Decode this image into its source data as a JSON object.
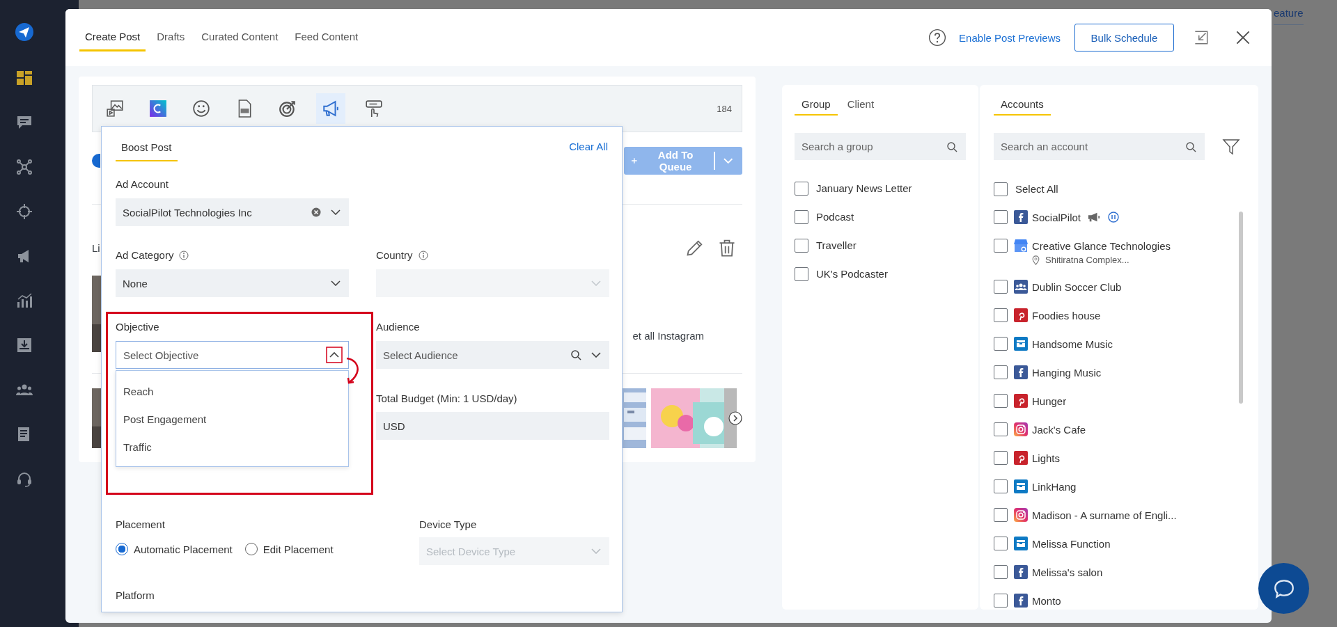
{
  "sidebar": {
    "items": [
      {
        "kind": "dashboard",
        "selected": true
      },
      {
        "kind": "chat",
        "selected": false
      },
      {
        "kind": "network",
        "selected": false
      },
      {
        "kind": "target",
        "selected": false
      },
      {
        "kind": "megaphone",
        "selected": false
      },
      {
        "kind": "chart",
        "selected": false
      },
      {
        "kind": "inbox",
        "selected": false
      },
      {
        "kind": "people",
        "selected": false
      },
      {
        "kind": "document",
        "selected": false
      },
      {
        "kind": "headset",
        "selected": false
      }
    ]
  },
  "background": {
    "partial_text": "eature"
  },
  "modal": {
    "tabs": [
      {
        "label": "Create Post",
        "selected": true
      },
      {
        "label": "Drafts",
        "selected": false
      },
      {
        "label": "Curated Content",
        "selected": false
      },
      {
        "label": "Feed Content",
        "selected": false
      }
    ],
    "preview_link": "Enable Post Previews",
    "bulk_button": "Bulk Schedule"
  },
  "composer": {
    "tools": [
      {
        "kind": "media",
        "selected": false
      },
      {
        "kind": "canva",
        "selected": false
      },
      {
        "kind": "emoji",
        "selected": false
      },
      {
        "kind": "gif",
        "selected": false
      },
      {
        "kind": "target",
        "selected": false
      },
      {
        "kind": "megaphone",
        "selected": true
      },
      {
        "kind": "pointer",
        "selected": false
      }
    ],
    "char_count": "184",
    "toggle_on": true,
    "queue_button": "Add To Queue",
    "partial_label": "Li",
    "partial_text": "et all Instagram"
  },
  "boost": {
    "tab": "Boost Post",
    "clear": "Clear All",
    "ad_account": {
      "label": "Ad Account",
      "value": "SocialPilot Technologies Inc"
    },
    "ad_category": {
      "label": "Ad Category",
      "value": "None"
    },
    "country": {
      "label": "Country",
      "disabled": true
    },
    "objective": {
      "label": "Objective",
      "placeholder": "Select Objective",
      "expanded": true,
      "options": [
        "Reach",
        "Post Engagement",
        "Traffic"
      ]
    },
    "audience": {
      "label": "Audience",
      "placeholder": "Select Audience"
    },
    "budget": {
      "label": "Total Budget (Min: 1 USD/day)",
      "currency": "USD"
    },
    "placement": {
      "label": "Placement",
      "options": [
        {
          "label": "Automatic Placement",
          "selected": true
        },
        {
          "label": "Edit Placement",
          "selected": false
        }
      ]
    },
    "device": {
      "label": "Device Type",
      "placeholder": "Select Device Type",
      "disabled": true
    },
    "platform_label": "Platform"
  },
  "groups": {
    "tabs": [
      {
        "label": "Group",
        "selected": true
      },
      {
        "label": "Client",
        "selected": false
      }
    ],
    "search_placeholder": "Search a group",
    "items": [
      {
        "label": "January News Letter",
        "checked": false
      },
      {
        "label": "Podcast",
        "checked": false
      },
      {
        "label": "Traveller",
        "checked": false
      },
      {
        "label": "UK's Podcaster",
        "checked": false
      }
    ]
  },
  "accounts": {
    "tab": "Accounts",
    "search_placeholder": "Search an account",
    "select_all": {
      "label": "Select All",
      "checked": false
    },
    "items": [
      {
        "name": "SocialPilot",
        "kind": "facebook",
        "checked": false,
        "boosted": true,
        "paused": true
      },
      {
        "name": "Creative Glance Technologies",
        "kind": "google",
        "checked": false,
        "boosted": false,
        "paused": false,
        "location": "Shitiratna Complex..."
      },
      {
        "name": "Dublin Soccer Club",
        "kind": "group",
        "checked": false,
        "boosted": false,
        "paused": false
      },
      {
        "name": "Foodies house",
        "kind": "pinterest",
        "checked": false,
        "boosted": false,
        "paused": false
      },
      {
        "name": "Handsome Music",
        "kind": "business",
        "checked": false,
        "boosted": false,
        "paused": false
      },
      {
        "name": "Hanging Music",
        "kind": "facebook",
        "checked": false,
        "boosted": false,
        "paused": false
      },
      {
        "name": "Hunger",
        "kind": "pinterest",
        "checked": false,
        "boosted": false,
        "paused": false
      },
      {
        "name": "Jack's Cafe",
        "kind": "instagram",
        "checked": false,
        "boosted": false,
        "paused": false
      },
      {
        "name": "Lights",
        "kind": "pinterest",
        "checked": false,
        "boosted": false,
        "paused": false
      },
      {
        "name": "LinkHang",
        "kind": "business",
        "checked": false,
        "boosted": false,
        "paused": false
      },
      {
        "name": "Madison - A surname of Engli...",
        "kind": "instagram",
        "checked": false,
        "boosted": false,
        "paused": false
      },
      {
        "name": "Melissa Function",
        "kind": "business",
        "checked": false,
        "boosted": false,
        "paused": false
      },
      {
        "name": "Melissa's salon",
        "kind": "facebook",
        "checked": false,
        "boosted": false,
        "paused": false
      },
      {
        "name": "Monto",
        "kind": "facebook",
        "checked": false,
        "boosted": false,
        "paused": false
      }
    ]
  }
}
